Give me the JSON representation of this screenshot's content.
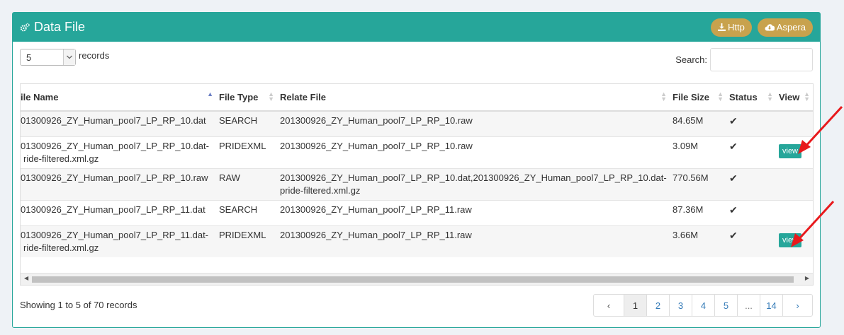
{
  "panel": {
    "title": "Data File"
  },
  "header_buttons": {
    "http": "Http",
    "aspera": "Aspera"
  },
  "length": {
    "value": "5",
    "label": "records"
  },
  "search": {
    "label": "Search:",
    "value": "",
    "placeholder": ""
  },
  "table": {
    "columns": [
      "ile Name",
      "File Type",
      "Relate File",
      "File Size",
      "Status",
      "View"
    ],
    "rows": [
      {
        "name": "01300926_ZY_Human_pool7_LP_RP_10.dat",
        "type": "SEARCH",
        "relate": "201300926_ZY_Human_pool7_LP_RP_10.raw",
        "size": "84.65M",
        "status": "✔",
        "view": ""
      },
      {
        "name": "01300926_ZY_Human_pool7_LP_RP_10.dat-ride-filtered.xml.gz",
        "type": "PRIDEXML",
        "relate": "201300926_ZY_Human_pool7_LP_RP_10.raw",
        "size": "3.09M",
        "status": "✔",
        "view": "view"
      },
      {
        "name": "01300926_ZY_Human_pool7_LP_RP_10.raw",
        "type": "RAW",
        "relate": "201300926_ZY_Human_pool7_LP_RP_10.dat,201300926_ZY_Human_pool7_LP_RP_10.dat-pride-filtered.xml.gz",
        "size": "770.56M",
        "status": "✔",
        "view": ""
      },
      {
        "name": "01300926_ZY_Human_pool7_LP_RP_11.dat",
        "type": "SEARCH",
        "relate": "201300926_ZY_Human_pool7_LP_RP_11.raw",
        "size": "87.36M",
        "status": "✔",
        "view": ""
      },
      {
        "name": "01300926_ZY_Human_pool7_LP_RP_11.dat-ride-filtered.xml.gz",
        "type": "PRIDEXML",
        "relate": "201300926_ZY_Human_pool7_LP_RP_11.raw",
        "size": "3.66M",
        "status": "✔",
        "view": "view"
      }
    ]
  },
  "info": "Showing 1 to 5 of 70 records",
  "pagination": {
    "prev": "‹",
    "pages": [
      "1",
      "2",
      "3",
      "4",
      "5",
      "...",
      "14"
    ],
    "next": "›"
  },
  "colors": {
    "accent": "#26a69a",
    "button_gold": "#c8a24d",
    "annotation_arrow": "#e8191c"
  },
  "icons": {
    "panel": "gears-icon",
    "http": "download-icon",
    "aspera": "cloud-download-icon"
  }
}
